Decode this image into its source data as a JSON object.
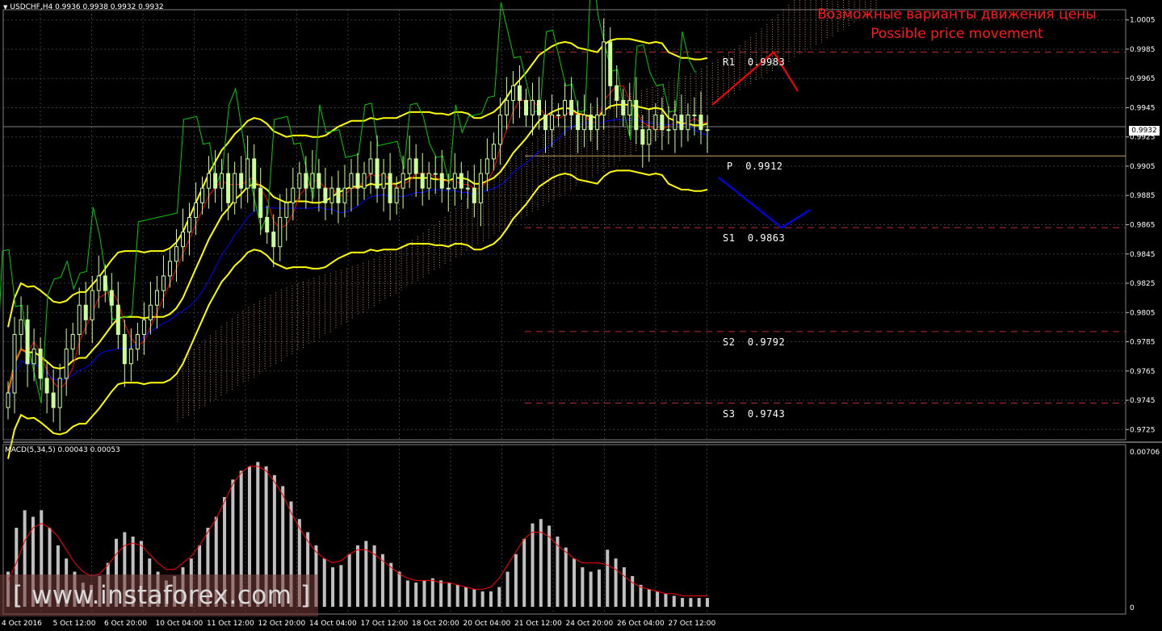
{
  "header": {
    "symbol": "USDCHF,H4",
    "ohlc": "0.9936 0.9938 0.9932 0.9932"
  },
  "annotation": {
    "title_ru": "Возможные варианты движения цены",
    "title_en": "Possible price movement"
  },
  "levels": [
    {
      "label": "R1",
      "value": "0.9983"
    },
    {
      "label": "P",
      "value": "0.9912"
    },
    {
      "label": "S1",
      "value": "0.9863"
    },
    {
      "label": "S2",
      "value": "0.9792"
    },
    {
      "label": "S3",
      "value": "0.9743"
    }
  ],
  "current_price": "0.9932",
  "macd": {
    "label": "MACD(5,34,5) 0.00043 0.00053",
    "axis_max": "0.00706",
    "axis_zero": "0"
  },
  "watermark": "[ www.instaforex.com ]",
  "colors": {
    "background": "#000000",
    "candle": "#ccff99",
    "bollinger": "#ffff00",
    "tenkan": "#ff0000",
    "kijun": "#0000ff",
    "chikou": "#00cc00",
    "cloud": "#ffb08a",
    "scenario_up": "#ff0000",
    "scenario_down": "#0000ff",
    "macd_hist": "#c0c0c0",
    "macd_signal": "#ff0000"
  },
  "chart_data": {
    "type": "candlestick",
    "price_axis_ticks": [
      "1.0005",
      "0.9985",
      "0.9965",
      "0.9945",
      "0.9925",
      "0.9905",
      "0.9885",
      "0.9865",
      "0.9845",
      "0.9825",
      "0.9805",
      "0.9785",
      "0.9765",
      "0.9745",
      "0.9725"
    ],
    "price_range": [
      0.9718,
      1.0012
    ],
    "time_labels": [
      "4 Oct 2016",
      "5 Oct 12:00",
      "6 Oct 20:00",
      "10 Oct 04:00",
      "11 Oct 12:00",
      "12 Oct 20:00",
      "14 Oct 04:00",
      "17 Oct 12:00",
      "18 Oct 20:00",
      "20 Oct 04:00",
      "21 Oct 12:00",
      "24 Oct 20:00",
      "26 Oct 04:00",
      "27 Oct 12:00"
    ],
    "pivot_levels": {
      "R1": 0.9983,
      "P": 0.9912,
      "S1": 0.9863,
      "S2": 0.9792,
      "S3": 0.9743
    },
    "series": [
      {
        "name": "USDCHF",
        "close": [
          0.975,
          0.979,
          0.98,
          0.977,
          0.978,
          0.976,
          0.975,
          0.974,
          0.976,
          0.978,
          0.979,
          0.981,
          0.98,
          0.982,
          0.983,
          0.982,
          0.981,
          0.979,
          0.977,
          0.978,
          0.979,
          0.98,
          0.981,
          0.982,
          0.983,
          0.984,
          0.985,
          0.986,
          0.987,
          0.988,
          0.989,
          0.99,
          0.989,
          0.99,
          0.988,
          0.99,
          0.989,
          0.991,
          0.989,
          0.987,
          0.986,
          0.985,
          0.987,
          0.988,
          0.989,
          0.99,
          0.989,
          0.99,
          0.989,
          0.988,
          0.989,
          0.988,
          0.989,
          0.99,
          0.989,
          0.99,
          0.991,
          0.989,
          0.99,
          0.988,
          0.989,
          0.99,
          0.991,
          0.99,
          0.989,
          0.99,
          0.99,
          0.989,
          0.989,
          0.99,
          0.989,
          0.989,
          0.988,
          0.99,
          0.991,
          0.992,
          0.994,
          0.995,
          0.996,
          0.995,
          0.994,
          0.995,
          0.994,
          0.993,
          0.994,
          0.994,
          0.995,
          0.994,
          0.993,
          0.994,
          0.993,
          0.994,
          0.999,
          0.996,
          0.995,
          0.994,
          0.995,
          0.993,
          0.992,
          0.993,
          0.994,
          0.993,
          0.993,
          0.994,
          0.993,
          0.994,
          0.994,
          0.993,
          0.993
        ]
      }
    ],
    "macd_histogram": [
      0.0016,
      0.0036,
      0.0044,
      0.0041,
      0.0044,
      0.0036,
      0.0028,
      0.0022,
      0.0016,
      0.0011,
      0.001,
      0.0014,
      0.002,
      0.0031,
      0.0034,
      0.0032,
      0.003,
      0.0022,
      0.0016,
      0.0012,
      0.0014,
      0.0018,
      0.0022,
      0.0028,
      0.0036,
      0.0041,
      0.005,
      0.0058,
      0.0062,
      0.0064,
      0.0066,
      0.0064,
      0.006,
      0.0055,
      0.0048,
      0.004,
      0.0034,
      0.0028,
      0.0022,
      0.0018,
      0.0019,
      0.0024,
      0.0028,
      0.003,
      0.0028,
      0.0024,
      0.002,
      0.0016,
      0.0012,
      0.0011,
      0.0012,
      0.0013,
      0.0012,
      0.0011,
      0.001,
      0.0009,
      0.0008,
      0.0007,
      0.0007,
      0.0009,
      0.0016,
      0.0024,
      0.0031,
      0.0038,
      0.004,
      0.0037,
      0.0032,
      0.0027,
      0.0022,
      0.0018,
      0.0016,
      0.0017,
      0.0026,
      0.0022,
      0.0018,
      0.0014,
      0.001,
      0.0008,
      0.0007,
      0.0006,
      0.0005,
      0.0004,
      0.0004,
      0.0004,
      0.0004
    ],
    "macd_signal": [
      0.0012,
      0.002,
      0.003,
      0.0036,
      0.0038,
      0.0036,
      0.0032,
      0.0026,
      0.002,
      0.0016,
      0.0014,
      0.0015,
      0.0019,
      0.0024,
      0.0028,
      0.0029,
      0.0028,
      0.0024,
      0.002,
      0.0017,
      0.0017,
      0.002,
      0.0023,
      0.0028,
      0.0034,
      0.004,
      0.0048,
      0.0056,
      0.0061,
      0.0064,
      0.0064,
      0.0062,
      0.0057,
      0.0051,
      0.0043,
      0.0036,
      0.003,
      0.0025,
      0.0022,
      0.002,
      0.0021,
      0.0024,
      0.0026,
      0.0026,
      0.0024,
      0.0021,
      0.0018,
      0.0015,
      0.0013,
      0.0012,
      0.0012,
      0.0012,
      0.0011,
      0.0011,
      0.001,
      0.0009,
      0.0008,
      0.0008,
      0.0009,
      0.0013,
      0.0019,
      0.0025,
      0.0031,
      0.0034,
      0.0034,
      0.0032,
      0.0028,
      0.0025,
      0.0022,
      0.002,
      0.002,
      0.002,
      0.0019,
      0.0017,
      0.0014,
      0.0011,
      0.0009,
      0.0008,
      0.0007,
      0.0006,
      0.0006,
      0.0005,
      0.0005,
      0.0005,
      0.0005
    ]
  }
}
